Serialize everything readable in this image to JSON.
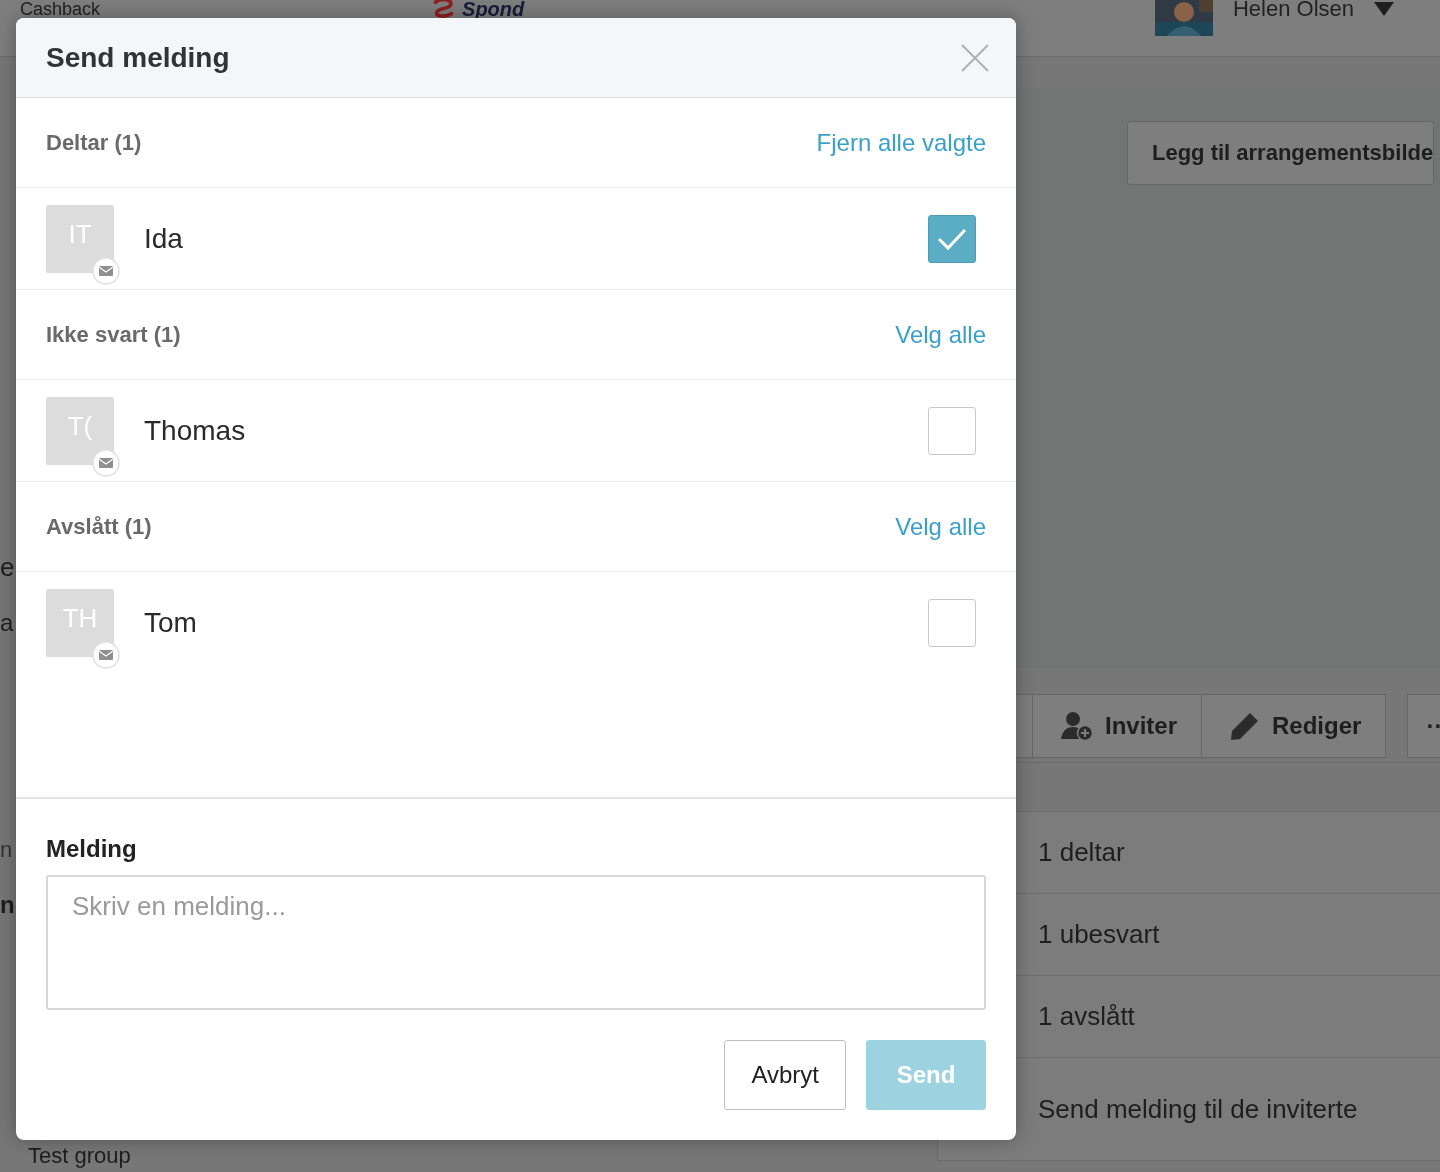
{
  "background": {
    "nav_link": "Cashback",
    "logo": "Spond",
    "user_name": "Helen Olsen",
    "left_fragments": [
      {
        "text": "e",
        "kind": "heading"
      },
      {
        "text": "a",
        "kind": "sub"
      },
      {
        "text": "n",
        "kind": "muted"
      },
      {
        "text": "n",
        "kind": "bold"
      }
    ],
    "footer_text": "Test group",
    "cover_button": "Legg til arrangementsbilde",
    "toolbar": [
      {
        "label": "Inviter",
        "kind": "invite"
      },
      {
        "label": "Rediger",
        "kind": "edit"
      },
      {
        "label": "··",
        "kind": "more"
      }
    ],
    "summary": [
      "1 deltar",
      "1 ubesvart",
      "1 avslått",
      "Send melding til de inviterte"
    ]
  },
  "dialog": {
    "title": "Send melding",
    "groups": [
      {
        "title": "Deltar (1)",
        "action": "Fjern alle valgte",
        "members": [
          {
            "initials": "IT",
            "name": "Ida",
            "checked": true
          }
        ]
      },
      {
        "title": "Ikke svart (1)",
        "action": "Velg alle",
        "members": [
          {
            "initials": "T(",
            "name": "Thomas",
            "checked": false
          }
        ]
      },
      {
        "title": "Avslått (1)",
        "action": "Velg alle",
        "members": [
          {
            "initials": "TH",
            "name": "Tom",
            "checked": false
          }
        ]
      }
    ],
    "message": {
      "label": "Melding",
      "placeholder": "Skriv en melding..."
    },
    "buttons": [
      {
        "label": "Avbryt",
        "kind": "secondary",
        "disabled": false
      },
      {
        "label": "Send",
        "kind": "primary",
        "disabled": true
      }
    ]
  }
}
